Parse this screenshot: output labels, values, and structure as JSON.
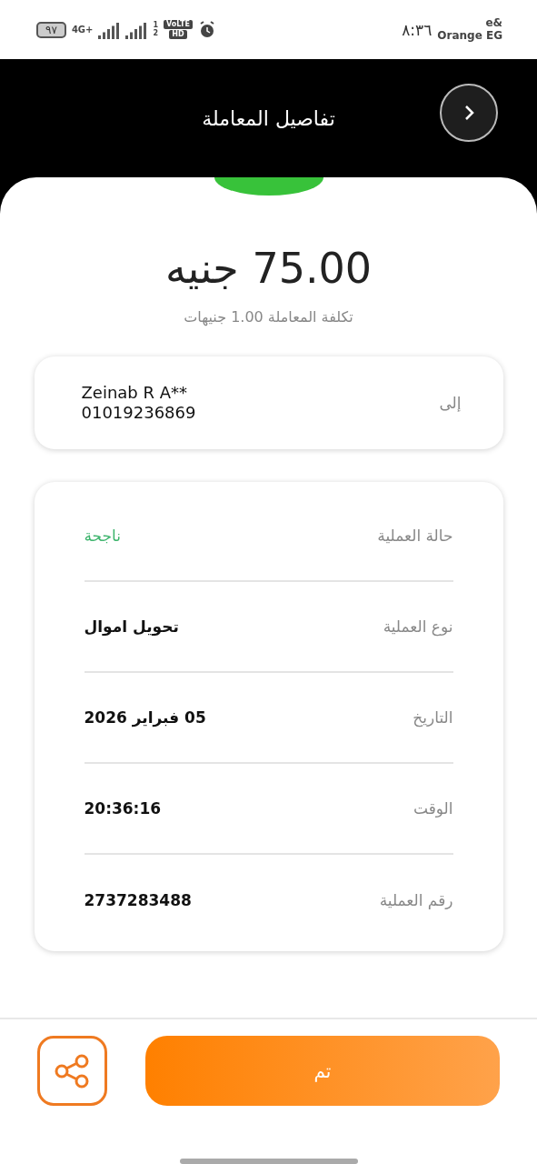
{
  "status_bar": {
    "battery": "٩٧",
    "network": "4G+",
    "sim_1": "1",
    "sim_2": "2",
    "volte": "VoLTE",
    "hd": "HD",
    "time": "٨:٣٦",
    "carrier_top": "e&",
    "carrier": "Orange EG"
  },
  "header": {
    "title": "تفاصيل المعاملة"
  },
  "amount": "75.00 جنيه",
  "fee": "تكلفة المعاملة 1.00 جنيهات",
  "recipient": {
    "label": "إلى",
    "name": "Zeinab R A**",
    "phone": "01019236869"
  },
  "details": [
    {
      "label": "حالة العملية",
      "value": "ناجحة",
      "kind": "status"
    },
    {
      "label": "نوع العملية",
      "value": "تحويل اموال",
      "kind": "text"
    },
    {
      "label": "التاريخ",
      "value": "05 فبراير 2026",
      "kind": "text"
    },
    {
      "label": "الوقت",
      "value": "20:36:16",
      "kind": "text"
    },
    {
      "label": "رقم العملية",
      "value": "2737283488",
      "kind": "text"
    }
  ],
  "done_button": "تم"
}
